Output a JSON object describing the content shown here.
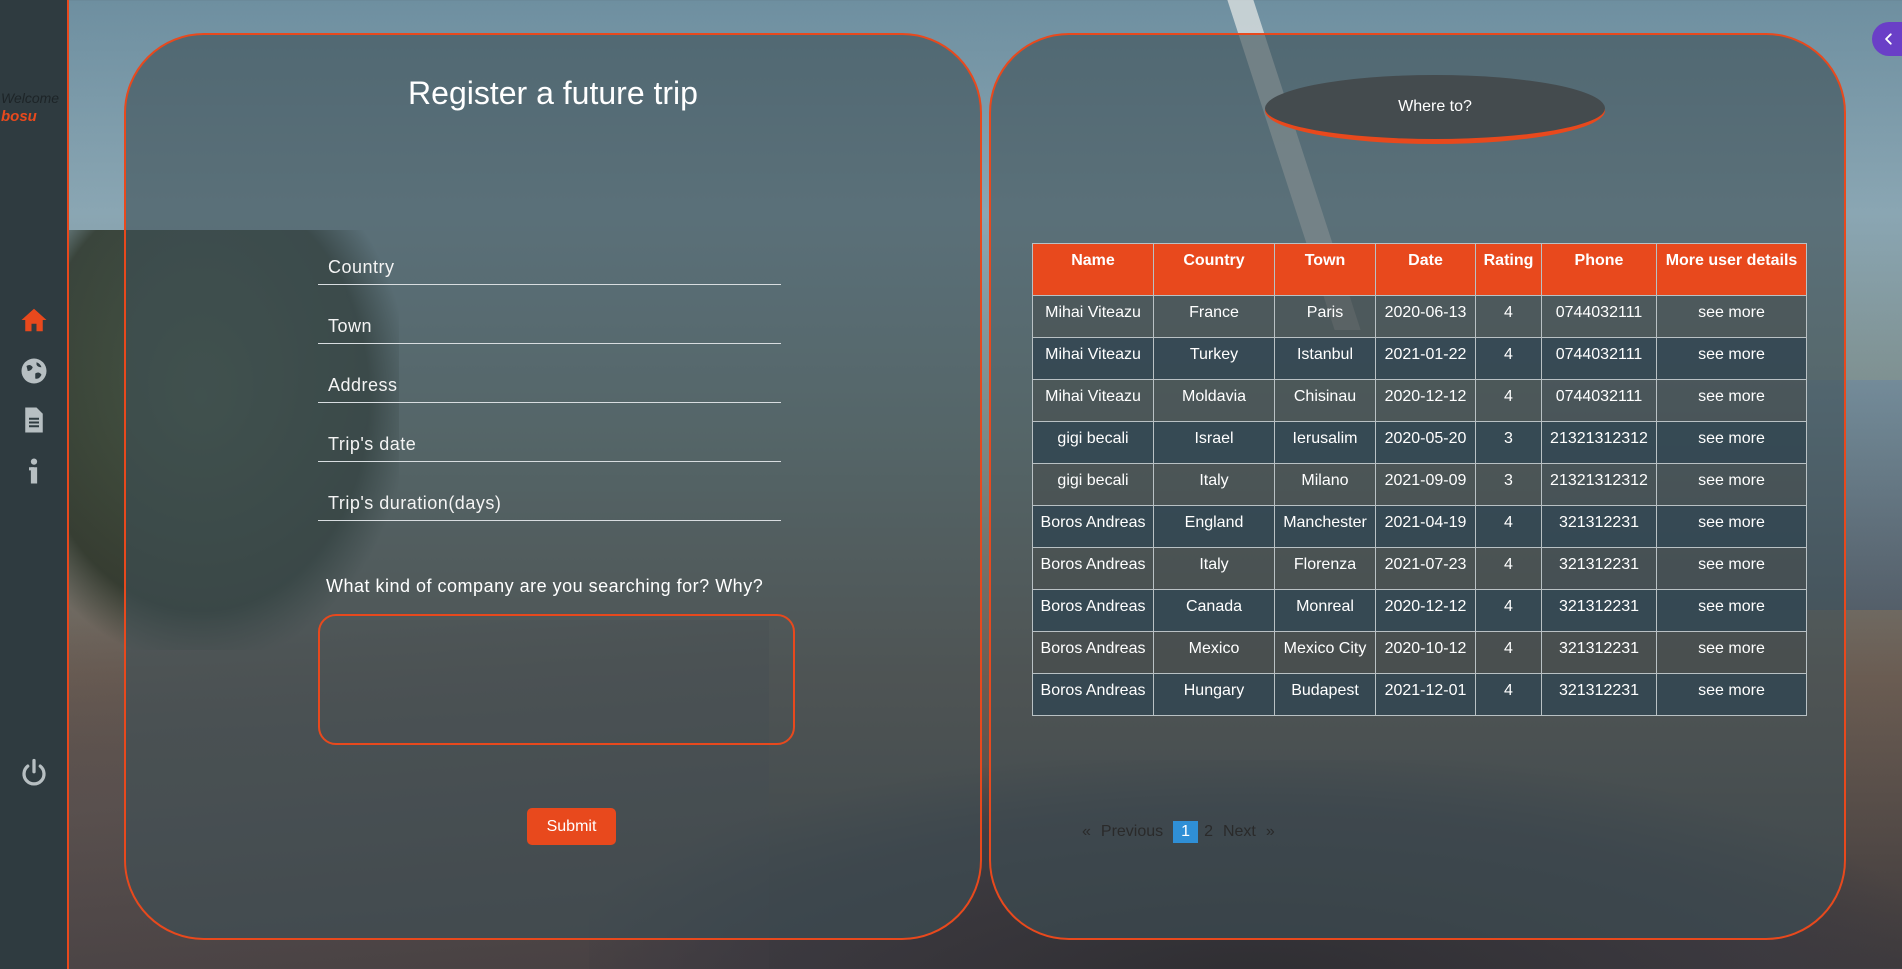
{
  "sidebar": {
    "welcome": "Welcome",
    "username": "bosu",
    "icons": [
      "home-icon",
      "globe-icon",
      "document-icon",
      "info-icon",
      "power-icon"
    ],
    "accent": "#e8491d",
    "background": "#2f3b40"
  },
  "form": {
    "title": "Register a future trip",
    "fields": {
      "country": "Country",
      "town": "Town",
      "address": "Address",
      "trip_date": "Trip's date",
      "trip_duration": "Trip's duration(days)"
    },
    "question": "What kind of company are you searching for? Why?",
    "textarea_value": "",
    "submit_label": "Submit"
  },
  "search": {
    "label": "Where to?"
  },
  "table": {
    "headers": [
      "Name",
      "Country",
      "Town",
      "Date",
      "Rating",
      "Phone",
      "More user details"
    ],
    "rows": [
      [
        "Mihai Viteazu",
        "France",
        "Paris",
        "2020-06-13",
        "4",
        "0744032111",
        "see more"
      ],
      [
        "Mihai Viteazu",
        "Turkey",
        "Istanbul",
        "2021-01-22",
        "4",
        "0744032111",
        "see more"
      ],
      [
        "Mihai Viteazu",
        "Moldavia",
        "Chisinau",
        "2020-12-12",
        "4",
        "0744032111",
        "see more"
      ],
      [
        "gigi becali",
        "Israel",
        "Ierusalim",
        "2020-05-20",
        "3",
        "21321312312",
        "see more"
      ],
      [
        "gigi becali",
        "Italy",
        "Milano",
        "2021-09-09",
        "3",
        "21321312312",
        "see more"
      ],
      [
        "Boros Andreas",
        "England",
        "Manchester",
        "2021-04-19",
        "4",
        "321312231",
        "see more"
      ],
      [
        "Boros Andreas",
        "Italy",
        "Florenza",
        "2021-07-23",
        "4",
        "321312231",
        "see more"
      ],
      [
        "Boros Andreas",
        "Canada",
        "Monreal",
        "2020-12-12",
        "4",
        "321312231",
        "see more"
      ],
      [
        "Boros Andreas",
        "Mexico",
        "Mexico City",
        "2020-10-12",
        "4",
        "321312231",
        "see more"
      ],
      [
        "Boros Andreas",
        "Hungary",
        "Budapest",
        "2021-12-01",
        "4",
        "321312231",
        "see more"
      ]
    ]
  },
  "pagination": {
    "first": "«",
    "previous": "Previous",
    "current": "1",
    "page2": "2",
    "next": "Next",
    "last": "»",
    "current_color": "#2f8fd6"
  },
  "collapse_icon": "chevron-left-icon",
  "collapse_color": "#6a3fc7"
}
